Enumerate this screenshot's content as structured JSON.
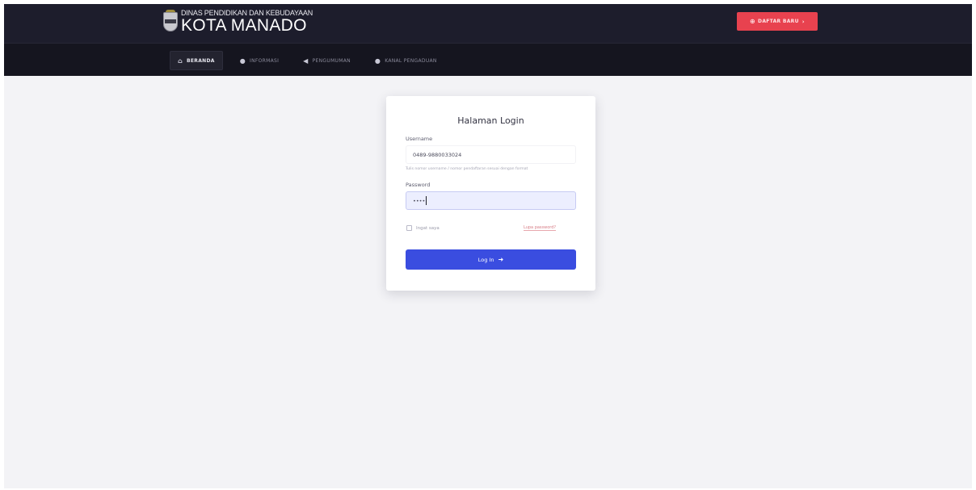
{
  "header": {
    "logo_subtitle": "DINAS PENDIDIKAN DAN KEBUDAYAAN",
    "logo_title": "KOTA MANADO",
    "signup_button": "DAFTAR BARU"
  },
  "nav": {
    "items": [
      {
        "label": "BERANDA",
        "icon": "home-icon",
        "glyph": "⌂"
      },
      {
        "label": "INFORMASI",
        "icon": "info-icon",
        "glyph": "●"
      },
      {
        "label": "PENGUMUMAN",
        "icon": "megaphone-icon",
        "glyph": "◀"
      },
      {
        "label": "KANAL PENGADUAN",
        "icon": "chat-icon",
        "glyph": "●"
      }
    ]
  },
  "login": {
    "title": "Halaman Login",
    "username_label": "Username",
    "username_value": "0489-9880033024",
    "username_hint": "Tulis nomor username / nomor pendaftaran sesuai dengan format",
    "password_label": "Password",
    "password_value": "••••",
    "remember_label": "Ingat saya",
    "forgot_link": "Lupa password?",
    "submit_label": "Log In"
  },
  "colors": {
    "accent": "#3a4de0",
    "signup": "#e8424f",
    "topbar": "#1d1d2c"
  }
}
